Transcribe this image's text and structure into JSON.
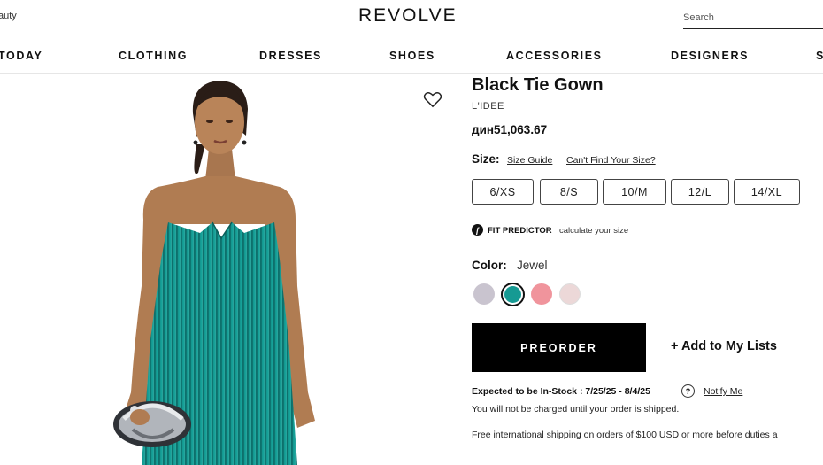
{
  "header": {
    "beauty_link": "auty",
    "logo": "REVOLVE",
    "search_placeholder": "Search"
  },
  "nav": {
    "items": [
      "TODAY",
      "CLOTHING",
      "DRESSES",
      "SHOES",
      "ACCESSORIES",
      "DESIGNERS",
      "S"
    ]
  },
  "product": {
    "title": "Black Tie Gown",
    "brand": "L'IDEE",
    "price": "дин51,063.67",
    "size_label": "Size:",
    "size_guide": "Size Guide",
    "cant_find": "Can't Find Your Size?",
    "sizes": [
      "6/XS",
      "8/S",
      "10/M",
      "12/L",
      "14/XL"
    ],
    "fit_predictor_icon": "fit-predictor-icon",
    "fit_predictor_label": "FIT PREDICTOR",
    "fit_predictor_sub": "calculate your size",
    "color_label": "Color:",
    "color_value": "Jewel",
    "swatches": [
      {
        "name": "lavender-grey",
        "color": "#c9c4cf"
      },
      {
        "name": "jewel",
        "color": "#169a93",
        "selected": true
      },
      {
        "name": "pink",
        "color": "#f0949c"
      },
      {
        "name": "blush",
        "color": "#ecd8d8"
      }
    ],
    "preorder_label": "PREORDER",
    "add_to_lists": "+ Add to My Lists",
    "expected": "Expected to be In-Stock : 7/25/25 - 8/4/25",
    "help_icon": "?",
    "notify": "Notify Me",
    "charged_note": "You will not be charged until your order is shipped.",
    "shipping_note": "Free international shipping on orders of $100 USD or more before duties a"
  },
  "colors": {
    "accent": "#000000",
    "gown": "#169a93"
  }
}
